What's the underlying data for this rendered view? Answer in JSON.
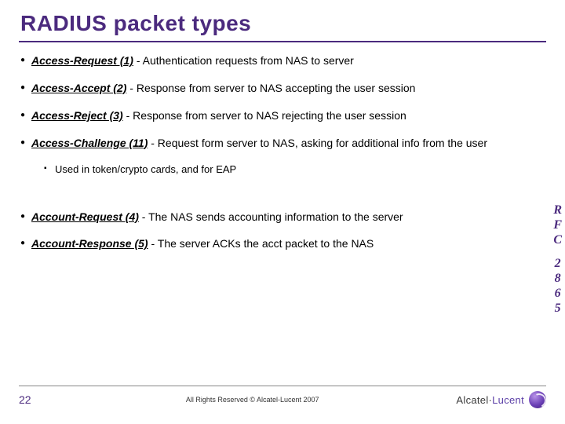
{
  "title": "RADIUS packet types",
  "items": [
    {
      "term": "Access-Request (1)",
      "desc": " - Authentication requests from  NAS to server"
    },
    {
      "term": "Access-Accept (2)",
      "desc": " - Response from server to NAS accepting the user session"
    },
    {
      "term": "Access-Reject (3)",
      "desc": " - Response from server to NAS rejecting the user session"
    },
    {
      "term": "Access-Challenge (11)",
      "desc": " - Request form server to NAS, asking for additional info from the user"
    }
  ],
  "subitem": "Used in token/crypto cards, and for EAP",
  "items2": [
    {
      "term": "Account-Request (4)",
      "desc": " - The NAS sends accounting information to the server"
    },
    {
      "term": "Account-Response (5)",
      "desc": " - The server ACKs the acct packet to the NAS"
    }
  ],
  "side": [
    "R",
    "F",
    "C",
    "2",
    "8",
    "6",
    "5"
  ],
  "footer": {
    "page": "22",
    "copyright": "All Rights Reserved © Alcatel-Lucent 2007",
    "brand_pre": "Alcatel·",
    "brand_post": "Lucent"
  }
}
